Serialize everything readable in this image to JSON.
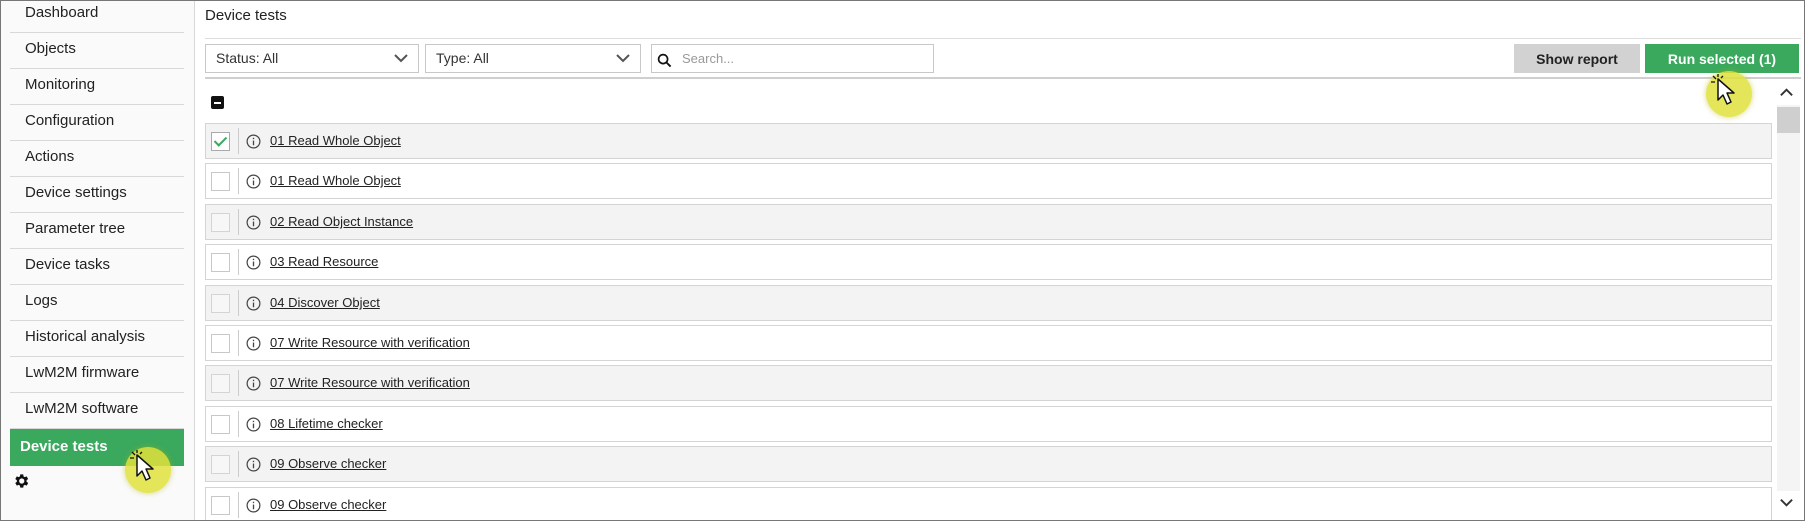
{
  "sidebar": {
    "items": [
      {
        "label": "Dashboard",
        "active": false
      },
      {
        "label": "Objects",
        "active": false
      },
      {
        "label": "Monitoring",
        "active": false
      },
      {
        "label": "Configuration",
        "active": false
      },
      {
        "label": "Actions",
        "active": false
      },
      {
        "label": "Device settings",
        "active": false
      },
      {
        "label": "Parameter tree",
        "active": false
      },
      {
        "label": "Device tasks",
        "active": false
      },
      {
        "label": "Logs",
        "active": false
      },
      {
        "label": "Historical analysis",
        "active": false
      },
      {
        "label": "LwM2M firmware",
        "active": false
      },
      {
        "label": "LwM2M software",
        "active": false
      },
      {
        "label": "Device tests",
        "active": true
      }
    ],
    "settings_icon": "gear-icon"
  },
  "main": {
    "title": "Device tests",
    "filters": {
      "status": "Status: All",
      "type": "Type: All"
    },
    "search": {
      "placeholder": "Search...",
      "value": ""
    },
    "buttons": {
      "show_report": "Show report",
      "run_selected": "Run selected (1)"
    },
    "tests": [
      {
        "name": "01 Read Whole Object",
        "checked": true,
        "disabled": false
      },
      {
        "name": "01 Read Whole Object",
        "checked": false,
        "disabled": false
      },
      {
        "name": "02 Read Object Instance",
        "checked": false,
        "disabled": true
      },
      {
        "name": "03 Read Resource",
        "checked": false,
        "disabled": false
      },
      {
        "name": "04 Discover Object",
        "checked": false,
        "disabled": true
      },
      {
        "name": "07 Write Resource with verification",
        "checked": false,
        "disabled": false
      },
      {
        "name": "07 Write Resource with verification",
        "checked": false,
        "disabled": true
      },
      {
        "name": "08 Lifetime checker",
        "checked": false,
        "disabled": false
      },
      {
        "name": "09 Observe checker",
        "checked": false,
        "disabled": true
      },
      {
        "name": "09 Observe checker",
        "checked": false,
        "disabled": false
      }
    ]
  },
  "colors": {
    "accent": "#3aa95d",
    "secondary_button": "#d2d2d2"
  }
}
